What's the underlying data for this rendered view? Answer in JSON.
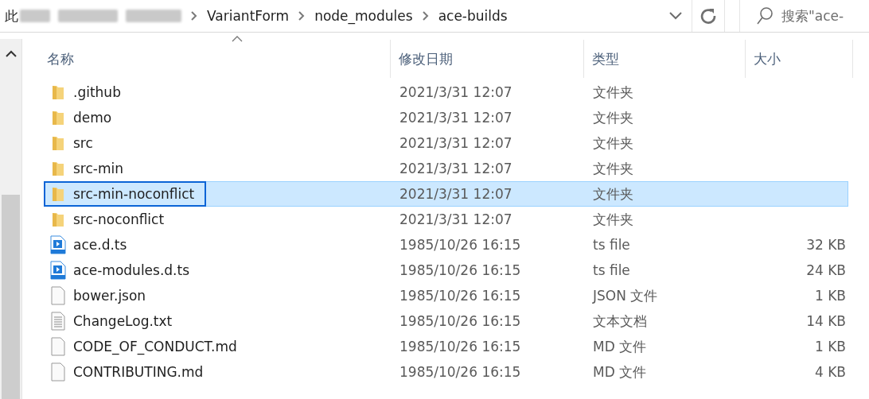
{
  "address_bar": {
    "prefix": "此",
    "path": [
      "VariantForm",
      "node_modules",
      "ace-builds"
    ]
  },
  "search": {
    "placeholder": "搜索\"ace-"
  },
  "table": {
    "columns": [
      "名称",
      "修改日期",
      "类型",
      "大小"
    ],
    "rows": [
      {
        "name": ".github",
        "date": "2021/3/31 12:07",
        "type": "文件夹",
        "kind": "folder",
        "selected": false
      },
      {
        "name": "demo",
        "date": "2021/3/31 12:07",
        "type": "文件夹",
        "kind": "folder",
        "selected": false
      },
      {
        "name": "src",
        "date": "2021/3/31 12:07",
        "type": "文件夹",
        "kind": "folder",
        "selected": false
      },
      {
        "name": "src-min",
        "date": "2021/3/31 12:07",
        "type": "文件夹",
        "kind": "folder",
        "selected": false
      },
      {
        "name": "src-min-noconflict",
        "date": "2021/3/31 12:07",
        "type": "文件夹",
        "kind": "folder",
        "selected": true
      },
      {
        "name": "src-noconflict",
        "date": "2021/3/31 12:07",
        "type": "文件夹",
        "kind": "folder",
        "selected": false
      },
      {
        "name": "ace.d.ts",
        "date": "1985/10/26 16:15",
        "type": "ts file",
        "size": "32 KB",
        "kind": "video",
        "selected": false
      },
      {
        "name": "ace-modules.d.ts",
        "date": "1985/10/26 16:15",
        "type": "ts file",
        "size": "24 KB",
        "kind": "video",
        "selected": false
      },
      {
        "name": "bower.json",
        "date": "1985/10/26 16:15",
        "type": "JSON 文件",
        "size": "1 KB",
        "kind": "blank",
        "selected": false
      },
      {
        "name": "ChangeLog.txt",
        "date": "1985/10/26 16:15",
        "type": "文本文档",
        "size": "14 KB",
        "kind": "text",
        "selected": false
      },
      {
        "name": "CODE_OF_CONDUCT.md",
        "date": "1985/10/26 16:15",
        "type": "MD 文件",
        "size": "1 KB",
        "kind": "blank",
        "selected": false
      },
      {
        "name": "CONTRIBUTING.md",
        "date": "1985/10/26 16:15",
        "type": "MD 文件",
        "size": "4 KB",
        "kind": "blank",
        "selected": false
      }
    ]
  }
}
